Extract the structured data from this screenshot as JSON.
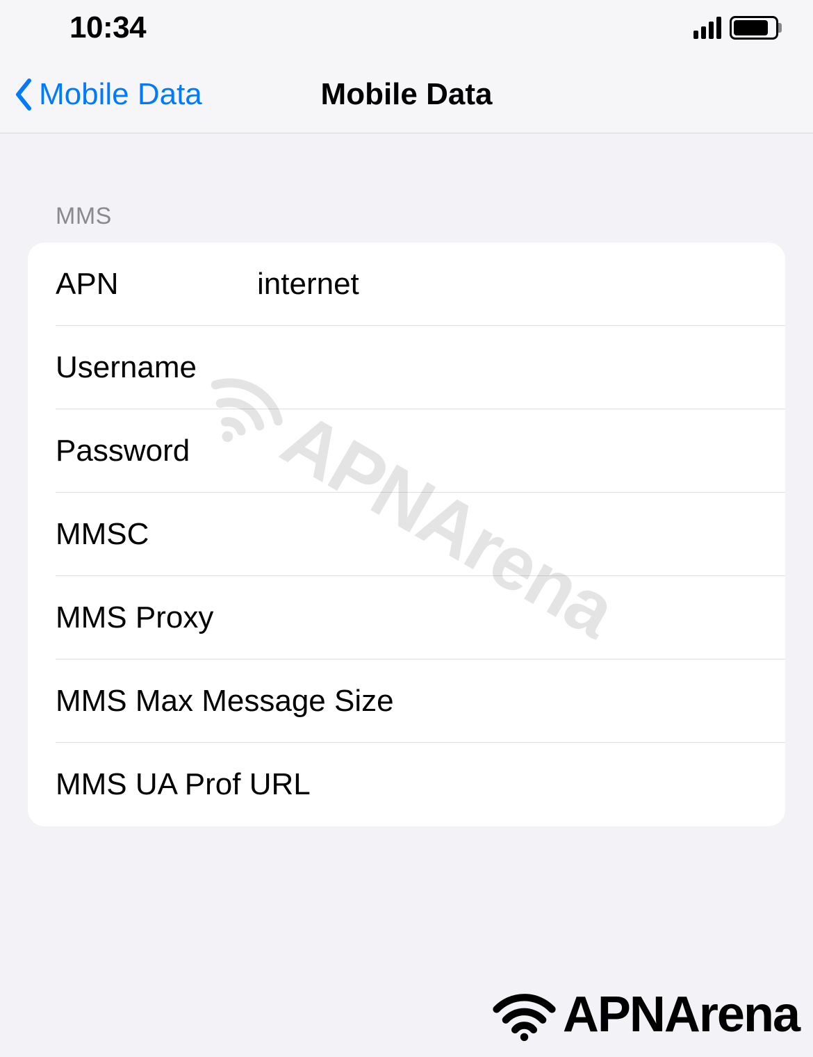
{
  "statusBar": {
    "time": "10:34"
  },
  "nav": {
    "backLabel": "Mobile Data",
    "title": "Mobile Data"
  },
  "sectionHeader": "MMS",
  "fields": {
    "apn": {
      "label": "APN",
      "value": "internet"
    },
    "username": {
      "label": "Username",
      "value": ""
    },
    "password": {
      "label": "Password",
      "value": ""
    },
    "mmsc": {
      "label": "MMSC",
      "value": ""
    },
    "mmsProxy": {
      "label": "MMS Proxy",
      "value": ""
    },
    "mmsMaxSize": {
      "label": "MMS Max Message Size",
      "value": ""
    },
    "mmsUaProf": {
      "label": "MMS UA Prof URL",
      "value": ""
    }
  },
  "watermark": {
    "text": "APNArena"
  },
  "brand": {
    "text": "APNArena"
  }
}
